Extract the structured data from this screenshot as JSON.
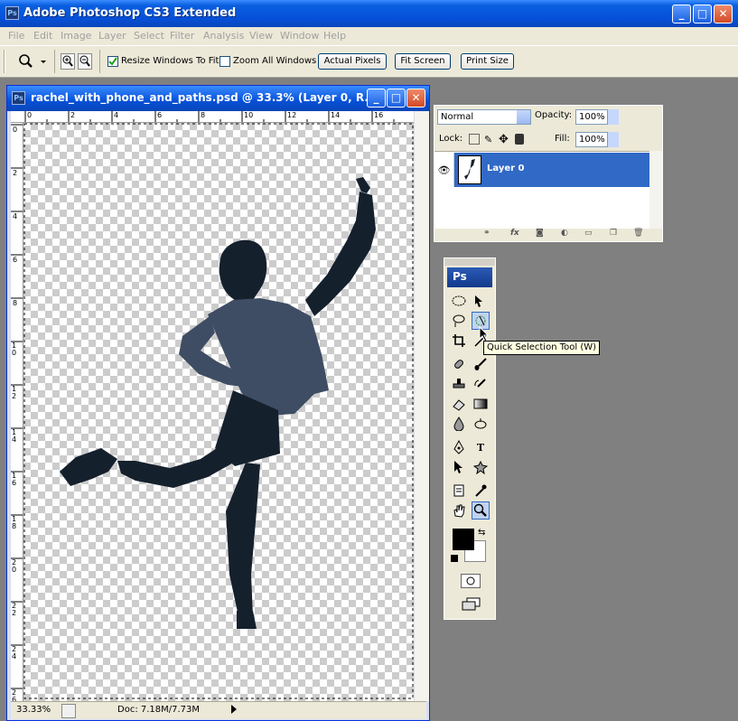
{
  "app": {
    "title": "Adobe Photoshop CS3 Extended",
    "logo": "Ps",
    "window_buttons": [
      "_",
      "□",
      "✕"
    ]
  },
  "menu": [
    "File",
    "Edit",
    "Image",
    "Layer",
    "Select",
    "Filter",
    "Analysis",
    "View",
    "Window",
    "Help"
  ],
  "options_bar": {
    "resize_windows_label": "Resize Windows To Fit",
    "resize_windows_checked": true,
    "zoom_all_label": "Zoom All Windows",
    "zoom_all_checked": false,
    "actual_pixels": "Actual Pixels",
    "fit_screen": "Fit Screen",
    "print_size": "Print Size"
  },
  "document": {
    "title": "rachel_with_phone_and_paths.psd @ 33.3% (Layer 0, R...",
    "ruler_top": [
      "0",
      "2",
      "4",
      "6",
      "8",
      "10",
      "12",
      "14",
      "16"
    ],
    "ruler_left": [
      "0",
      "2",
      "4",
      "6",
      "8",
      "10",
      "12",
      "14",
      "16",
      "18",
      "20",
      "22",
      "24",
      "26"
    ],
    "zoom": "33.33%",
    "doc_size": "Doc: 7.18M/7.73M"
  },
  "layers": {
    "blend_mode": "Normal",
    "opacity_label": "Opacity:",
    "opacity": "100%",
    "lock_label": "Lock:",
    "fill_label": "Fill:",
    "fill": "100%",
    "items": [
      {
        "name": "Layer 0",
        "visible": true,
        "selected": true
      }
    ]
  },
  "toolbox": {
    "logo": "Ps",
    "tooltip": "Quick Selection Tool (W)",
    "foreground_color": "#000000",
    "background_color": "#ffffff"
  }
}
